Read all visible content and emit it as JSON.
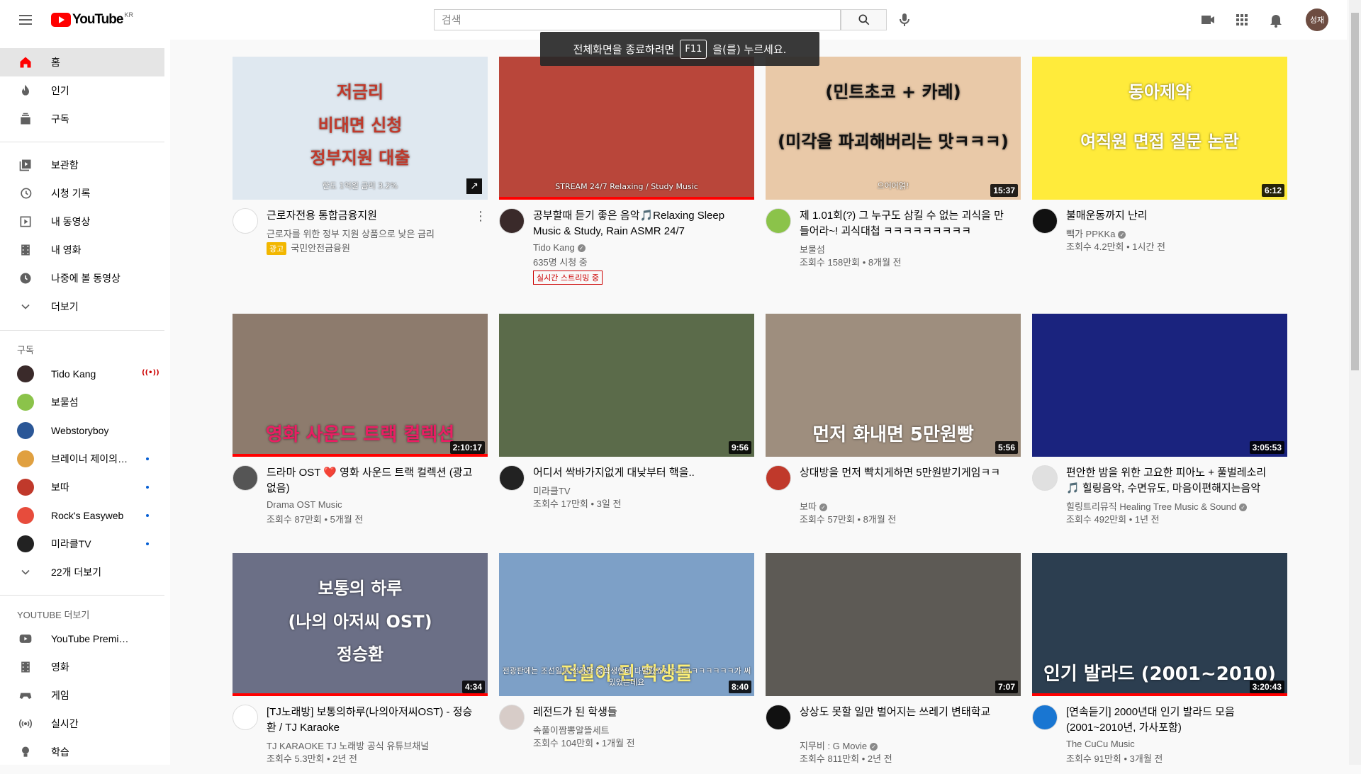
{
  "header": {
    "logo_text": "YouTube",
    "logo_region": "KR",
    "search_placeholder": "검색",
    "avatar_text": "성재"
  },
  "fullscreen_toast": {
    "before": "전체화면을 종료하려면",
    "key": "F11",
    "after": "을(를) 누르세요."
  },
  "sidebar": {
    "main": [
      {
        "label": "홈",
        "icon": "home-icon",
        "active": true
      },
      {
        "label": "인기",
        "icon": "trending-icon"
      },
      {
        "label": "구독",
        "icon": "subscriptions-icon"
      }
    ],
    "library": [
      {
        "label": "보관함",
        "icon": "library-icon"
      },
      {
        "label": "시청 기록",
        "icon": "history-icon"
      },
      {
        "label": "내 동영상",
        "icon": "my-videos-icon"
      },
      {
        "label": "내 영화",
        "icon": "my-movies-icon"
      },
      {
        "label": "나중에 볼 동영상",
        "icon": "watch-later-icon"
      },
      {
        "label": "더보기",
        "icon": "chevron-down-icon"
      }
    ],
    "subscriptions_heading": "구독",
    "subscriptions": [
      {
        "label": "Tido Kang",
        "live": true,
        "color": "#3a2a2a"
      },
      {
        "label": "보물섬",
        "dot": false,
        "color": "#8bc34a"
      },
      {
        "label": "Webstoryboy",
        "dot": false,
        "color": "#2b5797"
      },
      {
        "label": "브레이너 제이의 숲",
        "dot": true,
        "color": "#e0a040"
      },
      {
        "label": "보따",
        "dot": true,
        "color": "#c0392b"
      },
      {
        "label": "Rock's Easyweb",
        "dot": true,
        "color": "#e74c3c"
      },
      {
        "label": "미라클TV",
        "dot": true,
        "color": "#222222"
      }
    ],
    "more_subs": "22개 더보기",
    "more_youtube_heading": "YOUTUBE 더보기",
    "more_youtube": [
      {
        "label": "YouTube Premium",
        "icon": "youtube-premium-icon"
      },
      {
        "label": "영화",
        "icon": "movies-icon"
      },
      {
        "label": "게임",
        "icon": "gaming-icon"
      },
      {
        "label": "실시간",
        "icon": "live-icon"
      },
      {
        "label": "학습",
        "icon": "learning-icon"
      }
    ]
  },
  "videos": [
    {
      "title": "근로자전용 통합금융지원",
      "channel": "근로자를 위한 정부 지원 상품으로 낮은 금리",
      "stats": "국민안전금융원",
      "ad": "광고",
      "thumb_bg": "#dfe8f0",
      "thumb_lines": [
        "저금리",
        "비대면 신청",
        "정부지원 대출"
      ],
      "thumb_sub": "한도 1억원  금리 3.2%",
      "thumb_color": "#c0392b",
      "is_ad": true,
      "av_color": "#ffffff"
    },
    {
      "title": "공부할때 듣기 좋은 음악🎵Relaxing Sleep Music & Study, Rain ASMR 24/7",
      "channel": "Tido Kang",
      "verified": true,
      "stats": "635명 시청 중",
      "live": "실시간 스트리밍 중",
      "thumb_bg": "#b9463a",
      "thumb_lines": [],
      "thumb_sub": "STREAM 24/7 Relaxing / Study Music",
      "av_color": "#3a2a2a",
      "progress": true
    },
    {
      "title": "제 1.01회(?) 그 누구도 삼킬 수 없는 괴식을 만들어라~! 괴식대첩 ㅋㅋㅋㅋㅋㅋㅋㅋㅋ",
      "channel": "보물섬",
      "stats": "조회수 158만회 • 8개월 전",
      "duration": "15:37",
      "thumb_bg": "#e9c9a8",
      "thumb_lines": [
        "(민트초코 + 카레)",
        "(미각을 파괴해버리는 맛ㅋㅋㅋ)"
      ],
      "thumb_sub": "으어어얽!",
      "thumb_color": "#111111",
      "av_color": "#8bc34a"
    },
    {
      "title": "불매운동까지 난리",
      "channel": "빽가 PPKKa",
      "verified": true,
      "stats": "조회수 4.2만회 • 1시간 전",
      "duration": "6:12",
      "thumb_bg": "#ffeb3b",
      "thumb_lines": [
        "동아제약",
        "여직원 면접 질문 논란"
      ],
      "thumb_color": "#ffffff",
      "av_color": "#111111"
    },
    {
      "title": "드라마 OST ❤️ 영화 사운드 트랙 컬렉션 (광고 없음)",
      "channel": "Drama OST Music",
      "stats": "조회수 87만회 • 5개월 전",
      "duration": "2:10:17",
      "thumb_bg": "#8d7b6d",
      "thumb_lines": [
        "영화 사운드 트랙 컬렉션"
      ],
      "thumb_color": "#e91e63",
      "av_color": "#555555",
      "progress": true
    },
    {
      "title": "어디서 싹바가지없게 대낮부터 핵을..",
      "channel": "미라클TV",
      "stats": "조회수 17만회 • 3일 전",
      "duration": "9:56",
      "thumb_bg": "#5b6b4a",
      "thumb_lines": [],
      "av_color": "#222222"
    },
    {
      "title": "상대방을 먼저 빡치게하면 5만원받기게임ㅋㅋ",
      "channel": "보따",
      "verified": true,
      "stats": "조회수 57만회 • 8개월 전",
      "duration": "5:56",
      "thumb_bg": "#9e8e7e",
      "thumb_lines": [
        "먼저 화내면 5만원빵"
      ],
      "thumb_color": "#ffffff",
      "av_color": "#c0392b"
    },
    {
      "title": "편안한 밤을 위한 고요한 피아노 + 풀벌레소리 🎵 힐링음악, 수면유도, 마음이편해지는음악",
      "channel": "힐링트리뮤직 Healing Tree Music & Sound",
      "verified": true,
      "stats": "조회수 492만회 • 1년 전",
      "duration": "3:05:53",
      "thumb_bg": "#1a237e",
      "thumb_lines": [],
      "av_color": "#e0e0e0"
    },
    {
      "title": "[TJ노래방] 보통의하루(나의아저씨OST) - 정승환 / TJ Karaoke",
      "channel": "TJ KARAOKE TJ 노래방 공식 유튜브채널",
      "stats": "조회수 5.3만회 • 2년 전",
      "duration": "4:34",
      "thumb_bg": "#6b6f86",
      "thumb_lines": [
        "보통의 하루",
        "(나의 아저씨 OST)",
        "정승환"
      ],
      "thumb_color": "#ffffff",
      "av_color": "#ffffff",
      "progress": true
    },
    {
      "title": "레전드가 된 학생들",
      "channel": "속풀이짬뽕알뜰세트",
      "stats": "조회수 104만회 • 1개월 전",
      "duration": "8:40",
      "thumb_bg": "#7da0c7",
      "thumb_lines": [
        "전설이 된 학생들"
      ],
      "thumb_sub": "전광판에는 조선일보 전광판 중학생한테 다털렸죠? ㅋㅋㅋㅋㅋㅋㅋㅋㅋ가 써있었는데요",
      "thumb_color": "#fff176",
      "av_color": "#d7ccc8"
    },
    {
      "title": "상상도 못할 일만 벌어지는 쓰레기 변태학교",
      "channel": "지무비 : G Movie",
      "verified": true,
      "stats": "조회수 811만회 • 2년 전",
      "duration": "7:07",
      "thumb_bg": "#5d5a55",
      "thumb_lines": [],
      "av_color": "#111111"
    },
    {
      "title": "[연속듣기] 2000년대 인기 발라드 모음 (2001~2010년, 가사포함)",
      "channel": "The CuCu Music",
      "stats": "조회수 91만회 • 3개월 전",
      "duration": "3:20:43",
      "thumb_bg": "#2c3e50",
      "thumb_lines": [
        "인기 발라드 (2001~2010)"
      ],
      "thumb_color": "#ffffff",
      "av_color": "#1976d2",
      "progress": true
    }
  ]
}
